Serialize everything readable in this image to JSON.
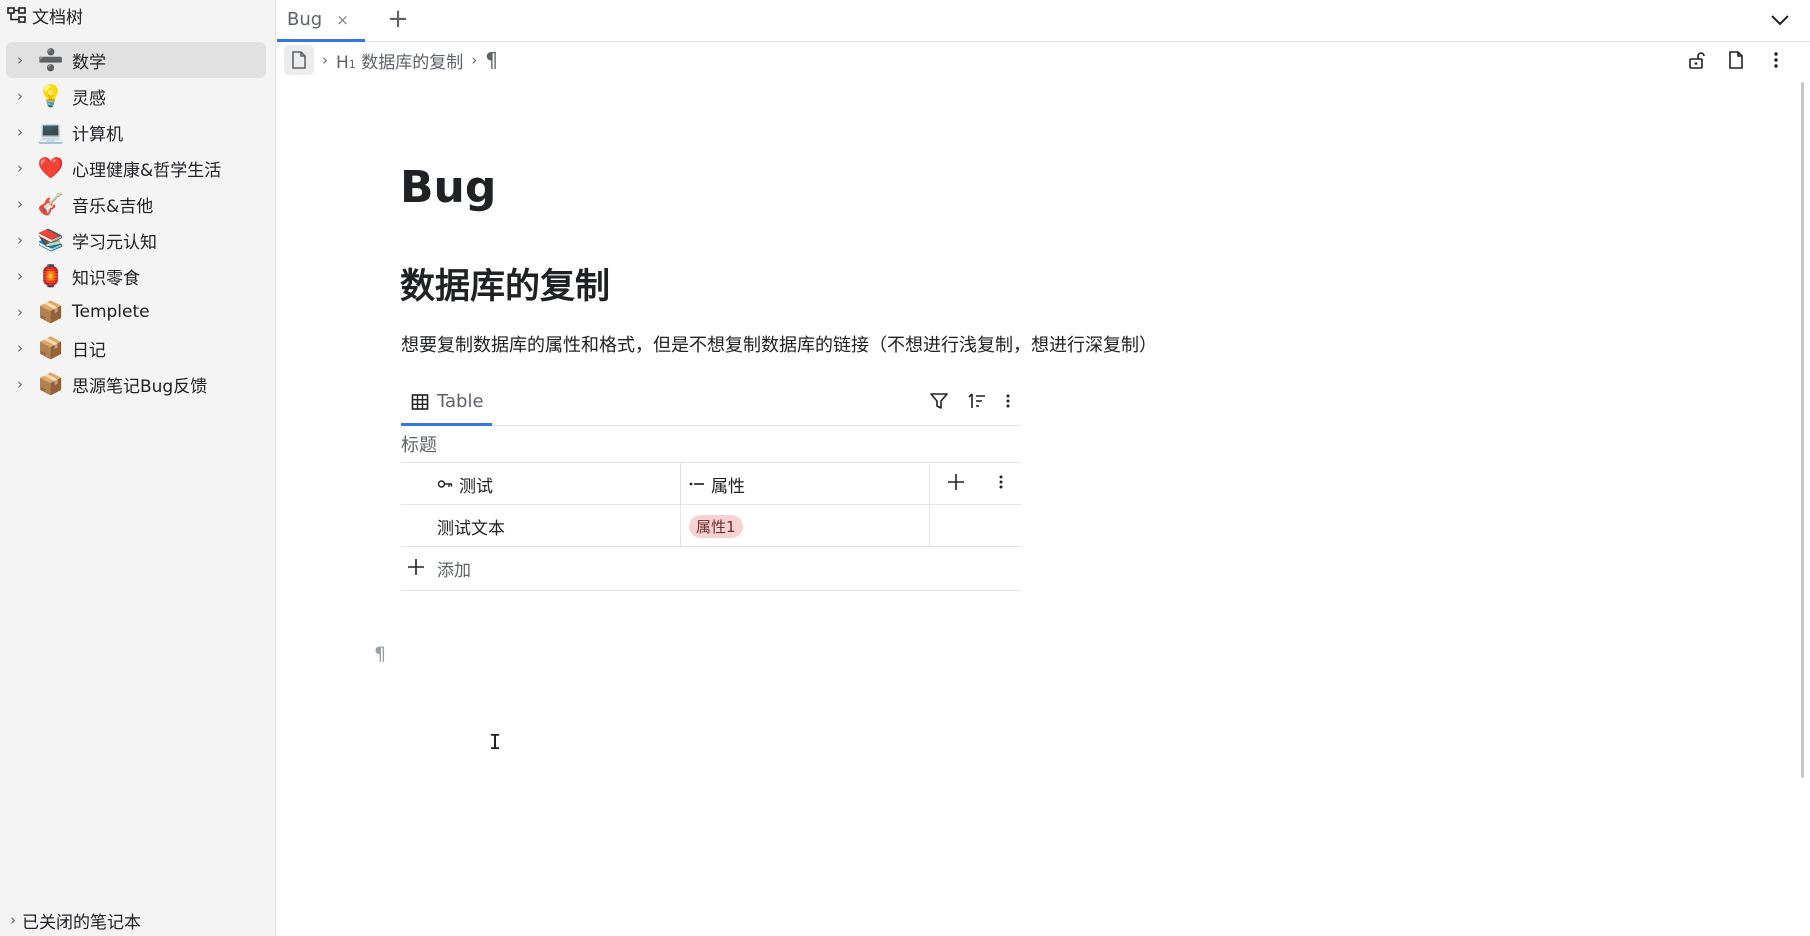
{
  "sidebar": {
    "title": "文档树",
    "items": [
      {
        "label": "数学",
        "emoji": "➗",
        "active": true
      },
      {
        "label": "灵感",
        "emoji": "💡"
      },
      {
        "label": "计算机",
        "emoji": "💻"
      },
      {
        "label": "心理健康&哲学生活",
        "emoji": "❤️"
      },
      {
        "label": "音乐&吉他",
        "emoji": "🎸"
      },
      {
        "label": "学习元认知",
        "emoji": "📚"
      },
      {
        "label": "知识零食",
        "emoji": "🏮"
      },
      {
        "label": "Templete",
        "emoji": "📦"
      },
      {
        "label": "日记",
        "emoji": "📦"
      },
      {
        "label": "思源笔记Bug反馈",
        "emoji": "📦"
      }
    ],
    "closed_notebooks": "已关闭的笔记本"
  },
  "tabs": {
    "active_title": "Bug",
    "close_glyph": "×",
    "add_glyph": "+"
  },
  "breadcrumb": {
    "h1_prefix": "H",
    "h1_sub": "1",
    "heading": "数据库的复制",
    "paragraph_mark": "¶"
  },
  "document": {
    "title": "Bug",
    "heading": "数据库的复制",
    "paragraph": "想要复制数据库的属性和格式，但是不想复制数据库的链接（不想进行浅复制，想进行深复制）",
    "empty_paragraph_mark": "¶",
    "cursor_glyph": "I"
  },
  "database": {
    "view_tab": "Table",
    "name": "标题",
    "columns": [
      {
        "label": "测试",
        "icon": "key-icon"
      },
      {
        "label": "属性",
        "icon": "select-icon"
      }
    ],
    "rows": [
      {
        "title": "测试文本",
        "tag": "属性1"
      }
    ],
    "add_row_label": "添加",
    "add_glyph": "+"
  },
  "colors": {
    "accent": "#3574f0",
    "tag_bg": "#f8d2d2",
    "sidebar_bg": "#f4f4f4"
  }
}
